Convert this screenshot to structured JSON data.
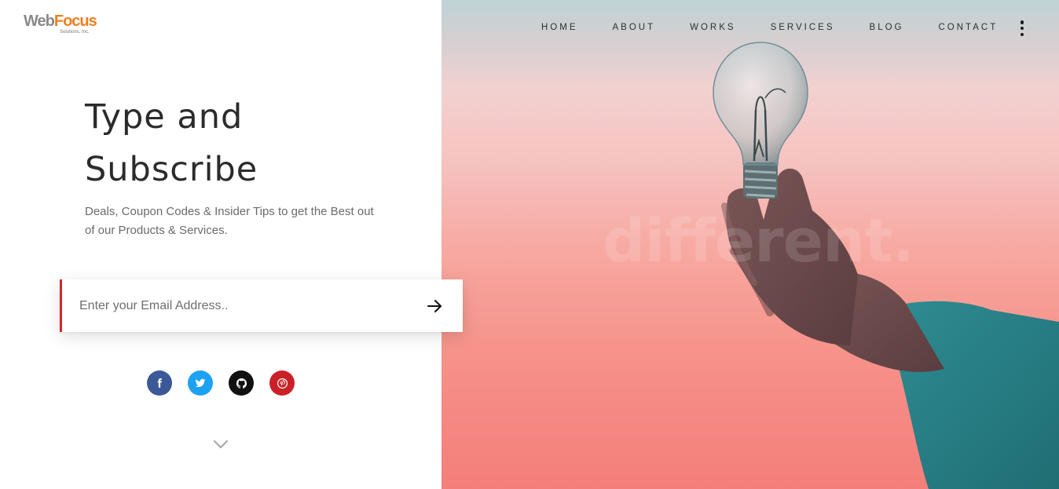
{
  "brand": {
    "name_part1": "Web",
    "name_part2": "Focus",
    "tagline": "Solutions, Inc.",
    "colors": {
      "part1": "#8a8a8a",
      "part2": "#f07f1e"
    }
  },
  "nav": {
    "items": [
      {
        "label": "HOME"
      },
      {
        "label": "ABOUT"
      },
      {
        "label": "WORKS"
      },
      {
        "label": "SERVICES"
      },
      {
        "label": "BLOG"
      },
      {
        "label": "CONTACT"
      }
    ],
    "menu_icon": "vertical-dots-icon"
  },
  "hero": {
    "headline_line1": "Type and",
    "headline_line2": "Subscribe",
    "subtitle": "Deals, Coupon Codes & Insider Tips to get the Best out of our Products & Services.",
    "watermark": "different."
  },
  "subscribe": {
    "placeholder": "Enter your Email Address..",
    "value": "",
    "submit_icon": "arrow-right-icon",
    "accent_color": "#d0282b"
  },
  "social": [
    {
      "network": "facebook",
      "icon": "facebook-icon",
      "color": "#3b5998"
    },
    {
      "network": "twitter",
      "icon": "twitter-icon",
      "color": "#1da1f2"
    },
    {
      "network": "github",
      "icon": "github-icon",
      "color": "#111111"
    },
    {
      "network": "pinterest",
      "icon": "pinterest-icon",
      "color": "#cb2027"
    }
  ],
  "scroll_indicator": {
    "icon": "chevron-down-icon"
  }
}
